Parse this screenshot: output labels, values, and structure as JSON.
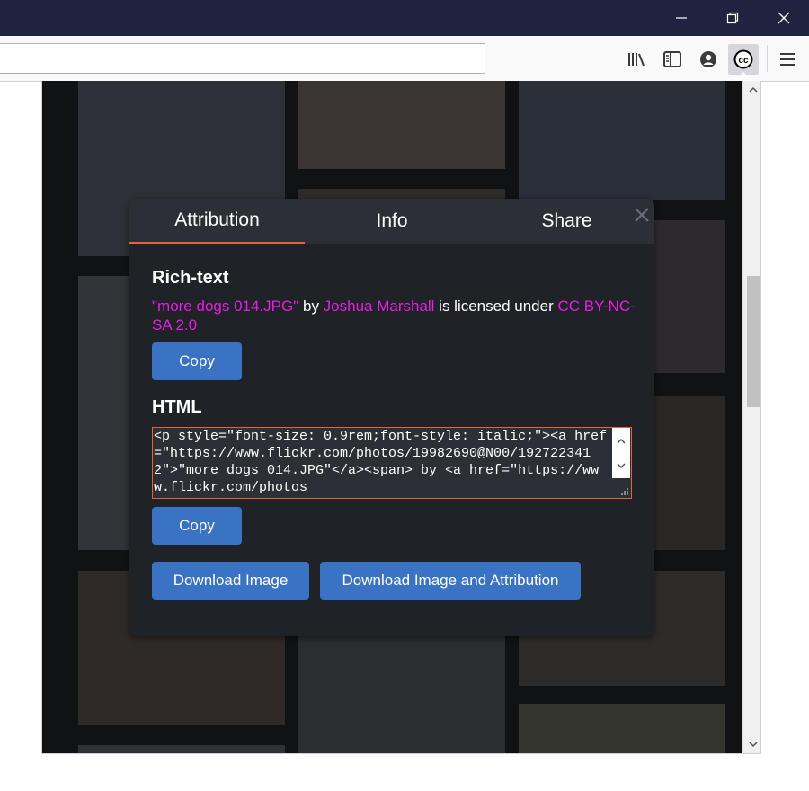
{
  "window": {
    "controls": [
      "minimize-icon",
      "restore-icon",
      "close-icon"
    ]
  },
  "toolbar": {
    "icons": [
      "library-icon",
      "sidebar-icon",
      "account-icon",
      "cc-icon",
      "menu-icon"
    ],
    "url": ""
  },
  "modal": {
    "tabs": [
      {
        "label": "Attribution",
        "active": true
      },
      {
        "label": "Info",
        "active": false
      },
      {
        "label": "Share",
        "active": false
      }
    ],
    "rich_text": {
      "heading": "Rich-text",
      "title_link": "\"more dogs 014.JPG\"",
      "by": " by ",
      "author_link": "Joshua Marshall",
      "licensed": " is licensed under ",
      "license_link": "CC BY-NC-SA 2.0",
      "copy_label": "Copy"
    },
    "html": {
      "heading": "HTML",
      "code": "<p style=\"font-size: 0.9rem;font-style: italic;\"><a href=\"https://www.flickr.com/photos/19982690@N00/1927223412\">\"more dogs 014.JPG\"</a><span> by <a href=\"https://www.flickr.com/photos",
      "copy_label": "Copy"
    },
    "download_image_label": "Download Image",
    "download_attribution_label": "Download Image and Attribution"
  },
  "colors": {
    "accent": "#e8623a",
    "link": "#e81ee3",
    "button": "#3b73c4",
    "modal_bg": "#1f2227"
  }
}
